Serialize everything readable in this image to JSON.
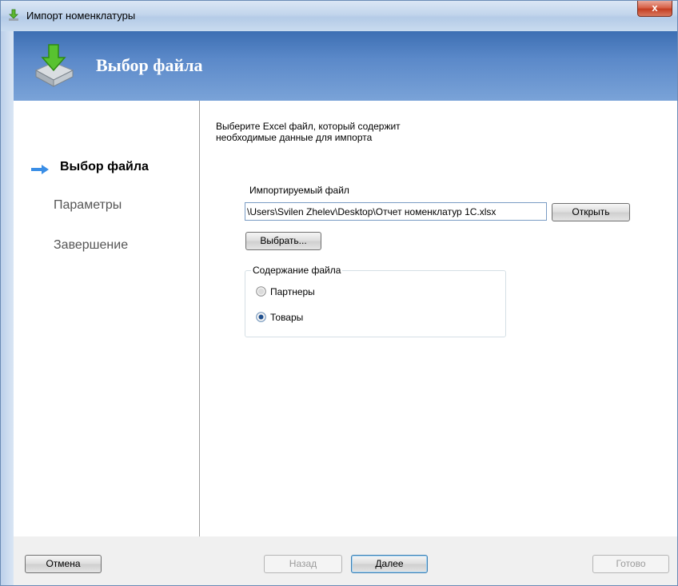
{
  "window": {
    "title": "Импорт номенклатуры",
    "close_glyph": "x"
  },
  "header": {
    "title": "Выбор файла",
    "icon": "import-download-icon"
  },
  "nav": {
    "items": [
      {
        "label": "Выбор файла",
        "active": true
      },
      {
        "label": "Параметры",
        "active": false
      },
      {
        "label": "Завершение",
        "active": false
      }
    ]
  },
  "main": {
    "description_line1": "Выберите Excel файл, который содержит",
    "description_line2": "необходимые данные для  импорта",
    "file_label": "Импортируемый файл",
    "file_value": "\\Users\\Svilen Zhelev\\Desktop\\Отчет номенклатур 1C.xlsx",
    "open_button": "Открыть",
    "choose_button": "Выбрать...",
    "group_title": "Содержание файла",
    "options": [
      {
        "label": "Партнеры",
        "selected": false
      },
      {
        "label": "Товары",
        "selected": true
      }
    ]
  },
  "footer": {
    "cancel": "Отмена",
    "back": "Назад",
    "next": "Далее",
    "finish": "Готово"
  },
  "colors": {
    "header": "#5b89c9",
    "accent": "#3c7fb1",
    "close": "#c23b1f"
  }
}
